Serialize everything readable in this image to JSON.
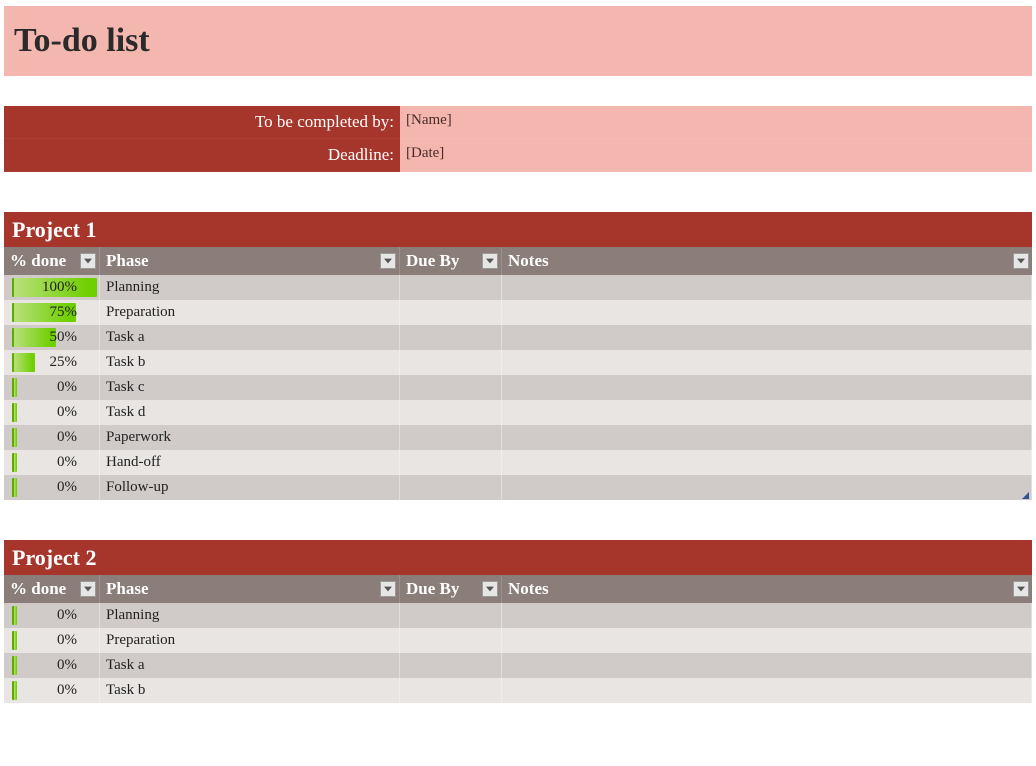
{
  "title": "To-do list",
  "meta": {
    "name_label": "To be completed by:",
    "name_value": "[Name]",
    "deadline_label": "Deadline:",
    "deadline_value": "[Date]"
  },
  "columns": [
    "% done",
    "Phase",
    "Due By",
    "Notes"
  ],
  "projects": [
    {
      "title": "Project 1",
      "rows": [
        {
          "pct": 100,
          "pct_label": "100%",
          "phase": "Planning",
          "due": "",
          "notes": ""
        },
        {
          "pct": 75,
          "pct_label": "75%",
          "phase": "Preparation",
          "due": "",
          "notes": ""
        },
        {
          "pct": 50,
          "pct_label": "50%",
          "phase": "Task a",
          "due": "",
          "notes": ""
        },
        {
          "pct": 25,
          "pct_label": "25%",
          "phase": "Task b",
          "due": "",
          "notes": ""
        },
        {
          "pct": 0,
          "pct_label": "0%",
          "phase": "Task c",
          "due": "",
          "notes": ""
        },
        {
          "pct": 0,
          "pct_label": "0%",
          "phase": "Task d",
          "due": "",
          "notes": ""
        },
        {
          "pct": 0,
          "pct_label": "0%",
          "phase": "Paperwork",
          "due": "",
          "notes": ""
        },
        {
          "pct": 0,
          "pct_label": "0%",
          "phase": "Hand-off",
          "due": "",
          "notes": ""
        },
        {
          "pct": 0,
          "pct_label": "0%",
          "phase": "Follow-up",
          "due": "",
          "notes": ""
        }
      ]
    },
    {
      "title": "Project 2",
      "rows": [
        {
          "pct": 0,
          "pct_label": "0%",
          "phase": "Planning",
          "due": "",
          "notes": ""
        },
        {
          "pct": 0,
          "pct_label": "0%",
          "phase": "Preparation",
          "due": "",
          "notes": ""
        },
        {
          "pct": 0,
          "pct_label": "0%",
          "phase": "Task a",
          "due": "",
          "notes": ""
        },
        {
          "pct": 0,
          "pct_label": "0%",
          "phase": "Task b",
          "due": "",
          "notes": ""
        }
      ]
    }
  ],
  "chart_data": [
    {
      "type": "bar",
      "title": "Project 1 — % done",
      "xlabel": "Phase",
      "ylabel": "% done",
      "ylim": [
        0,
        100
      ],
      "categories": [
        "Planning",
        "Preparation",
        "Task a",
        "Task b",
        "Task c",
        "Task d",
        "Paperwork",
        "Hand-off",
        "Follow-up"
      ],
      "values": [
        100,
        75,
        50,
        25,
        0,
        0,
        0,
        0,
        0
      ]
    },
    {
      "type": "bar",
      "title": "Project 2 — % done",
      "xlabel": "Phase",
      "ylabel": "% done",
      "ylim": [
        0,
        100
      ],
      "categories": [
        "Planning",
        "Preparation",
        "Task a",
        "Task b"
      ],
      "values": [
        0,
        0,
        0,
        0
      ]
    }
  ]
}
